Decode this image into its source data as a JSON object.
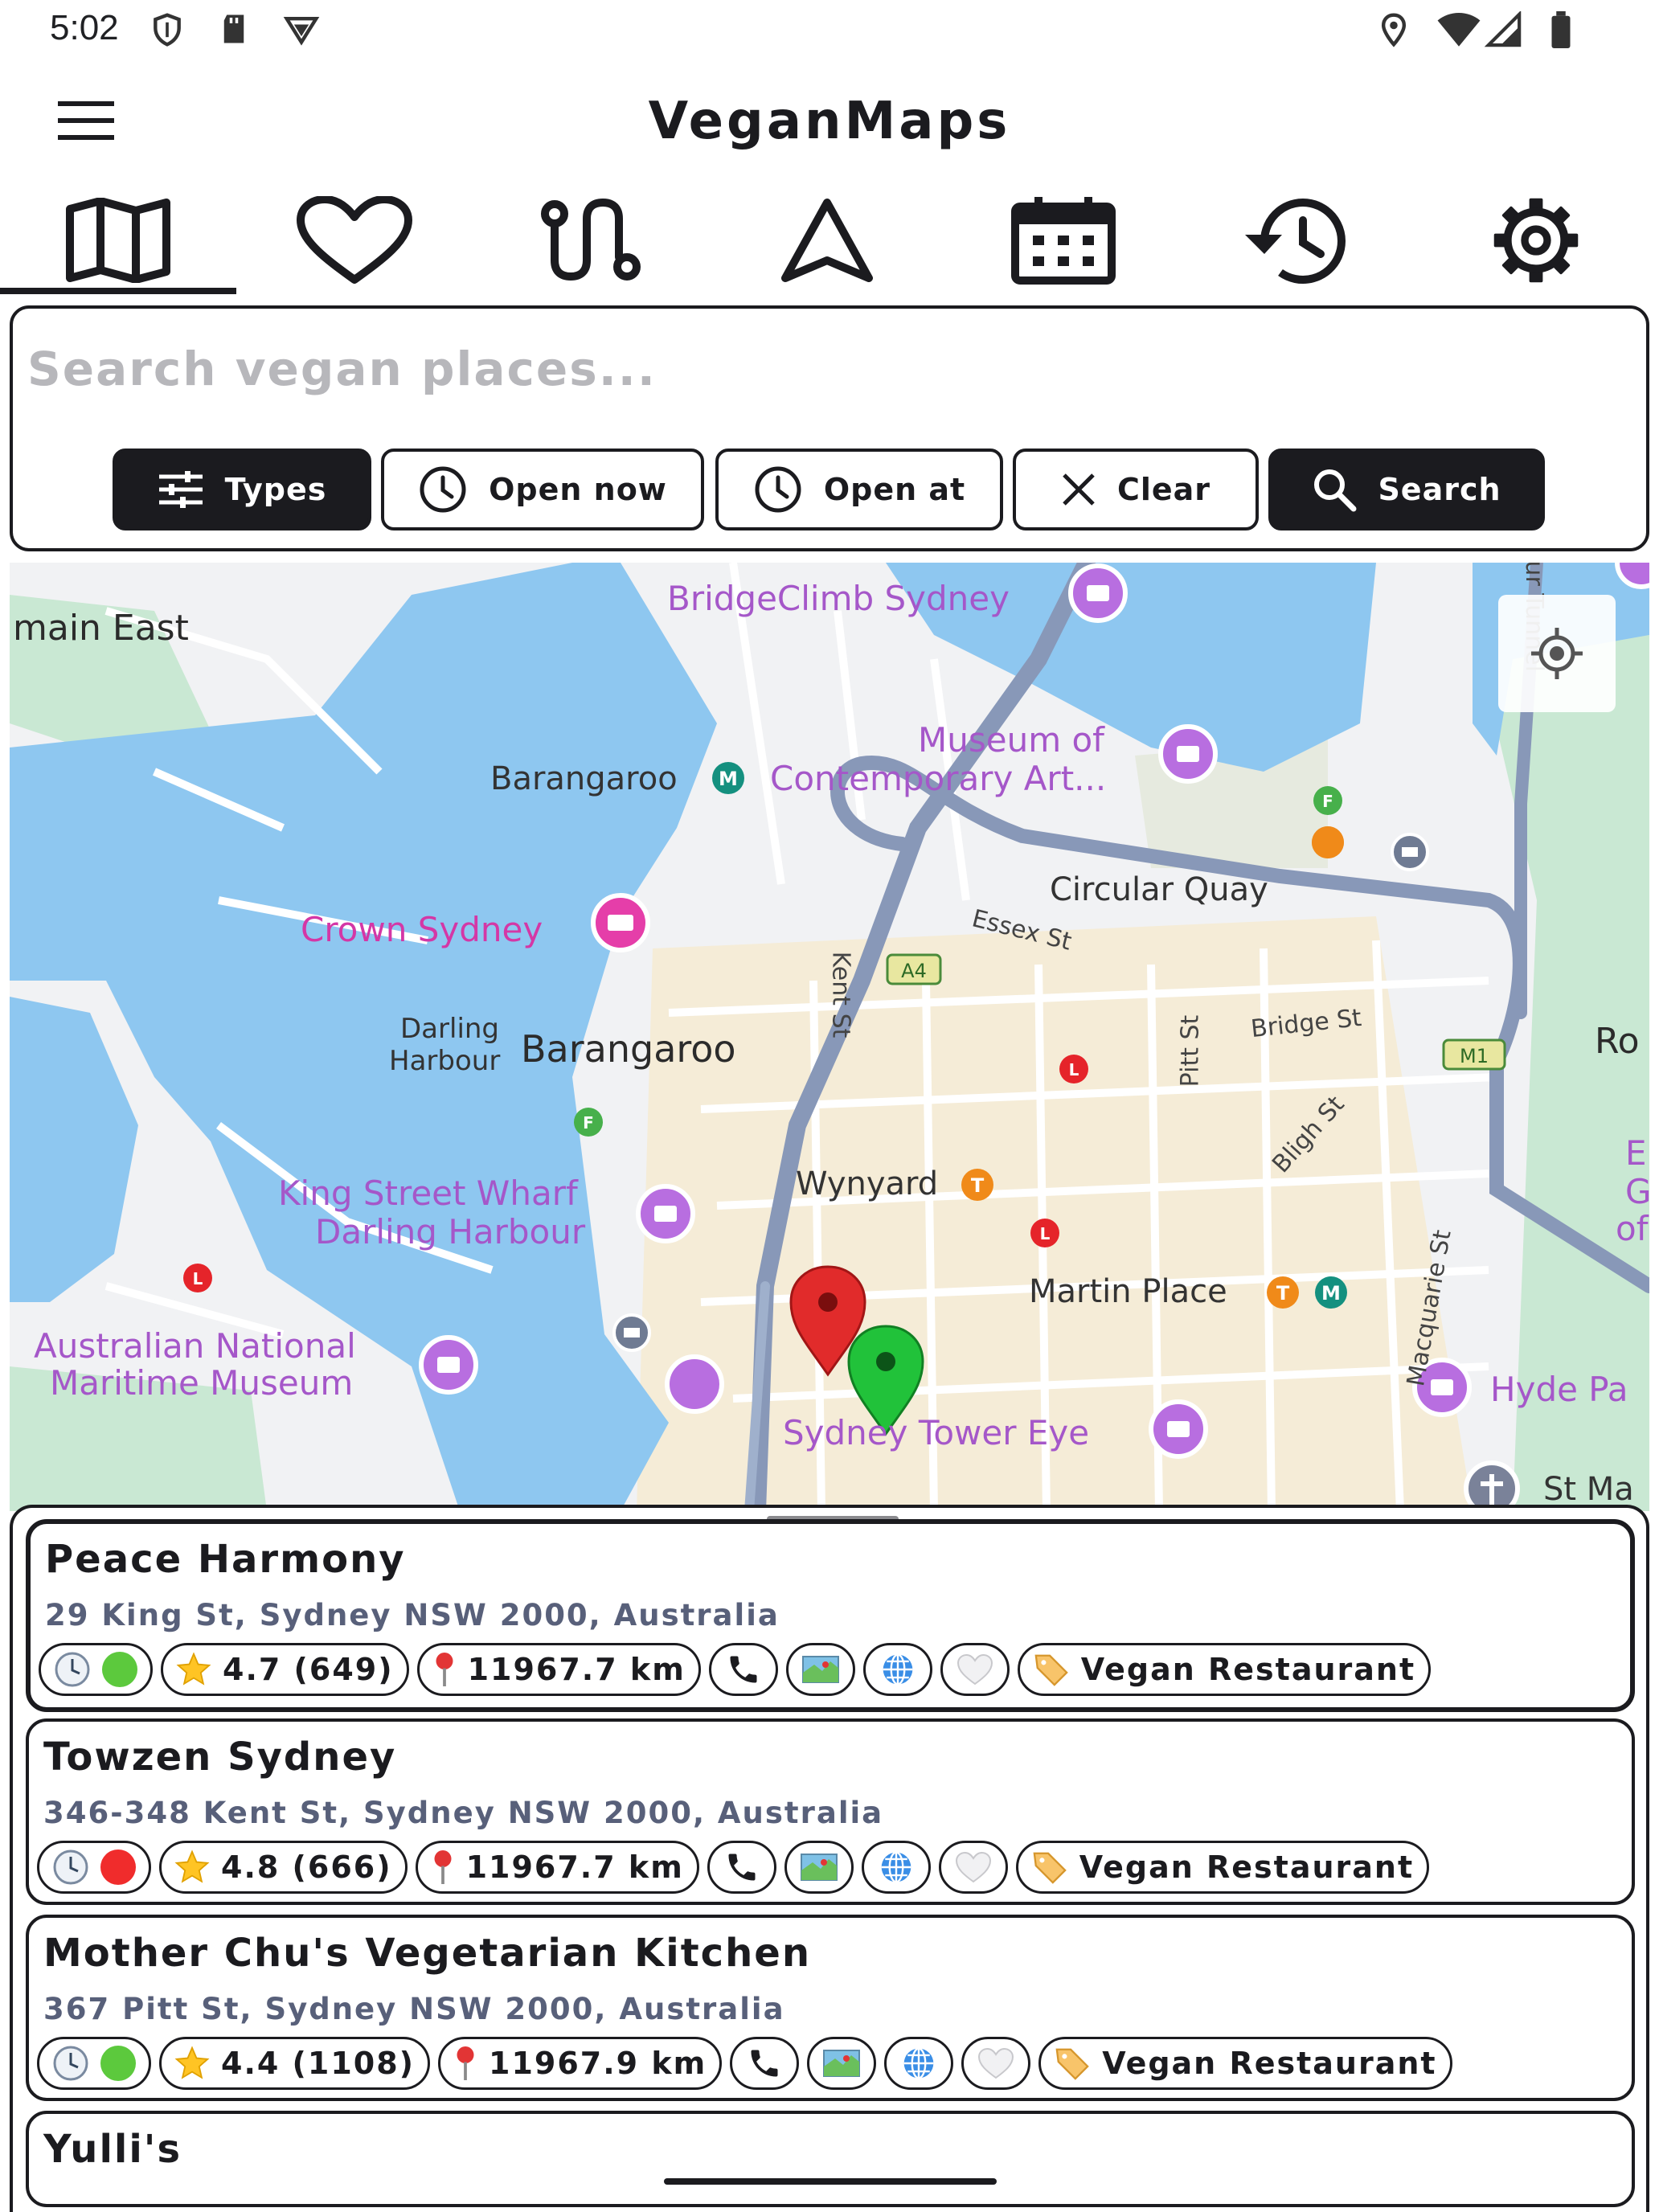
{
  "status_bar": {
    "time": "5:02",
    "icons": [
      "shield-icon",
      "sd-card-icon",
      "vpn-icon",
      "location-icon",
      "wifi-icon",
      "signal-icon",
      "battery-icon"
    ]
  },
  "app_bar": {
    "title": "VeganMaps",
    "menu_icon": "hamburger-menu-icon"
  },
  "tabs": [
    {
      "name": "map",
      "icon": "map-icon",
      "selected": true
    },
    {
      "name": "favorites",
      "icon": "heart-icon",
      "selected": false
    },
    {
      "name": "route",
      "icon": "route-icon",
      "selected": false
    },
    {
      "name": "navigate",
      "icon": "navigation-arrow-icon",
      "selected": false
    },
    {
      "name": "calendar",
      "icon": "calendar-icon",
      "selected": false
    },
    {
      "name": "history",
      "icon": "history-icon",
      "selected": false
    },
    {
      "name": "settings",
      "icon": "gear-icon",
      "selected": false
    }
  ],
  "search": {
    "placeholder": "Search vegan places...",
    "value": "",
    "buttons": {
      "types": "Types",
      "open_now": "Open now",
      "open_at": "Open at",
      "clear": "Clear",
      "search": "Search"
    }
  },
  "map": {
    "labels": {
      "domain_east": "main East",
      "bridgeclimb": "BridgeClimb Sydney",
      "museum_1": "Museum of",
      "museum_2": "Contemporary Art...",
      "barangaroo_station": "Barangaroo",
      "circular_quay": "Circular Quay",
      "essex": "Essex St",
      "kent": "Kent St",
      "crown": "Crown Sydney",
      "darling_1": "Darling",
      "darling_2": "Harbour",
      "barangaroo": "Barangaroo",
      "pitt": "Pitt St",
      "bridge": "Bridge St",
      "a4": "A4",
      "m1": "M1",
      "ro": "Ro",
      "wynyard": "Wynyard",
      "bligh": "Bligh St",
      "kingst_1": "King Street Wharf",
      "kingst_2": "Darling Harbour",
      "martin": "Martin Place",
      "macquarie": "Macquarie St",
      "maritime_1": "Australian National",
      "maritime_2": "Maritime Museum",
      "hyde": "Hyde Pa",
      "tower": "Sydney Tower Eye",
      "stma": "St Ma",
      "cahill": "our Tunnel",
      "edge_e": "E",
      "edge_g": "G",
      "edge_of": "of"
    },
    "location_button_icon": "my-location-icon",
    "colors": {
      "water": "#8ec7f0",
      "land": "#f1f2f4",
      "park": "#c9e8d3",
      "road": "#ffffff",
      "motorway": "#8898b8",
      "district": "#f5ecd7",
      "poi": "#a557c9"
    }
  },
  "results": [
    {
      "name": "Peace Harmony",
      "address": "29 King St, Sydney NSW 2000, Australia",
      "open_status": "open",
      "rating": "4.7 (649)",
      "distance": "11967.7 km",
      "category": "Vegan Restaurant"
    },
    {
      "name": "Towzen Sydney",
      "address": "346-348 Kent St, Sydney NSW 2000, Australia",
      "open_status": "closed",
      "rating": "4.8 (666)",
      "distance": "11967.7 km",
      "category": "Vegan Restaurant"
    },
    {
      "name": "Mother Chu's Vegetarian Kitchen",
      "address": "367 Pitt St, Sydney NSW 2000, Australia",
      "open_status": "open",
      "rating": "4.4 (1108)",
      "distance": "11967.9 km",
      "category": "Vegan Restaurant"
    },
    {
      "name": "Yulli's"
    }
  ],
  "pill_icons": [
    "clock-icon",
    "star-icon",
    "pin-icon",
    "phone-icon",
    "map-icon",
    "globe-icon",
    "heart-icon",
    "tag-icon"
  ],
  "status_colors": {
    "open": "#5cc93d",
    "closed": "#f02c2c"
  }
}
